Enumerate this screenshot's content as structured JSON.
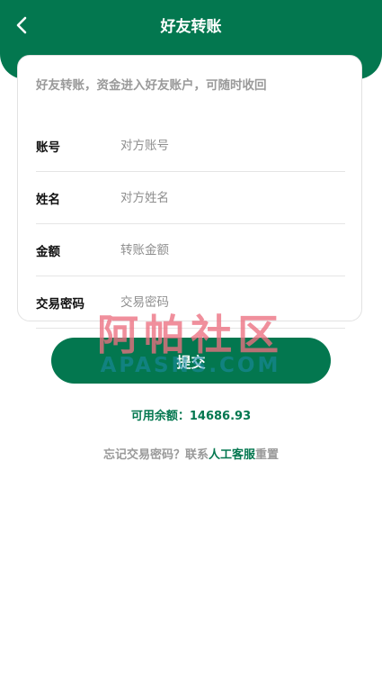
{
  "header": {
    "title": "好友转账"
  },
  "card": {
    "note": "好友转账，资金进入好友账户，可随时收回",
    "fields": [
      {
        "label": "账号",
        "placeholder": "对方账号",
        "value": ""
      },
      {
        "label": "姓名",
        "placeholder": "对方姓名",
        "value": ""
      },
      {
        "label": "金额",
        "placeholder": "转账金额",
        "value": ""
      },
      {
        "label": "交易密码",
        "placeholder": "交易密码",
        "value": ""
      }
    ]
  },
  "watermark": {
    "cn": "阿帕社区",
    "en": "APASNS.COM"
  },
  "submit_label": "提交",
  "balance": {
    "label": "可用余额：",
    "amount": "14686.93"
  },
  "footer": {
    "prefix": "忘记交易密码？联系",
    "link": "人工客服",
    "suffix": "重置"
  },
  "colors": {
    "primary": "#03774f",
    "muted_text": "#9a9a9a"
  }
}
